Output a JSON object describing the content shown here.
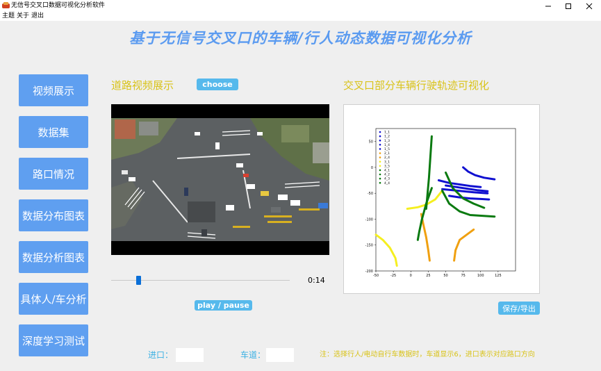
{
  "window": {
    "title": "无信号交叉口数据可视化分析软件"
  },
  "menu": [
    "主题",
    "关于",
    "退出"
  ],
  "header": {
    "title": "基于无信号交叉口的车辆/行人动态数据可视化分析"
  },
  "nav": [
    "视频展示",
    "数据集",
    "路口情况",
    "数据分布图表",
    "数据分析图表",
    "具体人/车分析",
    "深度学习测试"
  ],
  "video": {
    "section_title": "道路视频展示",
    "choose_label": "choose",
    "time": "0:14",
    "progress": 0.15,
    "play_label": "play / pause"
  },
  "trajectory": {
    "section_title": "交叉口部分车辆行驶轨迹可视化",
    "export_label": "保存/导出"
  },
  "footer": {
    "entry_label": "进口：",
    "lane_label": "车道：",
    "entry_value": "",
    "lane_value": "",
    "note": "注：选择行人/电动自行车数据时，车道显示6，进口表示对应路口方向"
  },
  "colors": {
    "accent": "#5f9ff0",
    "section": "#d9c319",
    "button": "#56b9ec",
    "label": "#3bb0e3"
  },
  "chart_data": {
    "type": "scatter",
    "xlim": [
      -50,
      150
    ],
    "ylim": [
      -200,
      75
    ],
    "xticks": [
      -50,
      -25,
      0,
      25,
      50,
      75,
      100,
      125
    ],
    "yticks": [
      50,
      0,
      -50,
      -100,
      -150,
      -200
    ],
    "legend_position": "top-left",
    "grid": false,
    "series": [
      {
        "name": "1_1",
        "color": "#1010d0",
        "points": [
          [
            40,
            -25
          ],
          [
            55,
            -30
          ],
          [
            70,
            -33
          ],
          [
            85,
            -36
          ],
          [
            100,
            -38
          ]
        ]
      },
      {
        "name": "1_2",
        "color": "#1010d0",
        "points": [
          [
            50,
            -35
          ],
          [
            65,
            -38
          ],
          [
            80,
            -41
          ],
          [
            95,
            -44
          ],
          [
            110,
            -46
          ]
        ]
      },
      {
        "name": "1_3",
        "color": "#1010d0",
        "points": [
          [
            45,
            -42
          ],
          [
            60,
            -44
          ],
          [
            75,
            -46
          ],
          [
            90,
            -48
          ],
          [
            110,
            -50
          ]
        ]
      },
      {
        "name": "1_4",
        "color": "#1010d0",
        "points": [
          [
            55,
            -55
          ],
          [
            70,
            -58
          ],
          [
            85,
            -60
          ],
          [
            100,
            -61
          ],
          [
            112,
            -62
          ]
        ]
      },
      {
        "name": "1_5",
        "color": "#1010d0",
        "points": [
          [
            75,
            0
          ],
          [
            82,
            -8
          ],
          [
            92,
            -15
          ],
          [
            105,
            -20
          ],
          [
            120,
            -23
          ]
        ]
      },
      {
        "name": "2_1",
        "color": "#f0a010",
        "points": [
          [
            15,
            -90
          ],
          [
            18,
            -110
          ],
          [
            22,
            -135
          ],
          [
            25,
            -160
          ],
          [
            27,
            -180
          ]
        ]
      },
      {
        "name": "2_4",
        "color": "#f0a010",
        "points": [
          [
            90,
            -120
          ],
          [
            80,
            -130
          ],
          [
            70,
            -140
          ],
          [
            64,
            -160
          ],
          [
            62,
            -180
          ]
        ]
      },
      {
        "name": "3_1",
        "color": "#f5ef20",
        "points": [
          [
            -50,
            -130
          ],
          [
            -40,
            -140
          ],
          [
            -30,
            -155
          ],
          [
            -22,
            -175
          ],
          [
            -20,
            -190
          ]
        ]
      },
      {
        "name": "3_5",
        "color": "#f5ef20",
        "points": [
          [
            -5,
            -80
          ],
          [
            10,
            -77
          ],
          [
            22,
            -72
          ],
          [
            35,
            -62
          ],
          [
            45,
            -45
          ]
        ]
      },
      {
        "name": "4_1",
        "color": "#0a7a10",
        "points": [
          [
            30,
            60
          ],
          [
            28,
            20
          ],
          [
            26,
            -20
          ],
          [
            24,
            -50
          ],
          [
            22,
            -80
          ]
        ]
      },
      {
        "name": "4_2",
        "color": "#0a7a10",
        "points": [
          [
            30,
            -40
          ],
          [
            22,
            -70
          ],
          [
            16,
            -100
          ],
          [
            12,
            -125
          ],
          [
            10,
            -140
          ]
        ]
      },
      {
        "name": "4_3",
        "color": "#0a7a10",
        "points": [
          [
            50,
            -10
          ],
          [
            60,
            -40
          ],
          [
            75,
            -60
          ],
          [
            90,
            -70
          ],
          [
            105,
            -78
          ]
        ]
      },
      {
        "name": "4_4",
        "color": "#0a7a10",
        "points": [
          [
            45,
            -45
          ],
          [
            55,
            -70
          ],
          [
            70,
            -85
          ],
          [
            85,
            -92
          ],
          [
            120,
            -95
          ]
        ]
      }
    ]
  }
}
